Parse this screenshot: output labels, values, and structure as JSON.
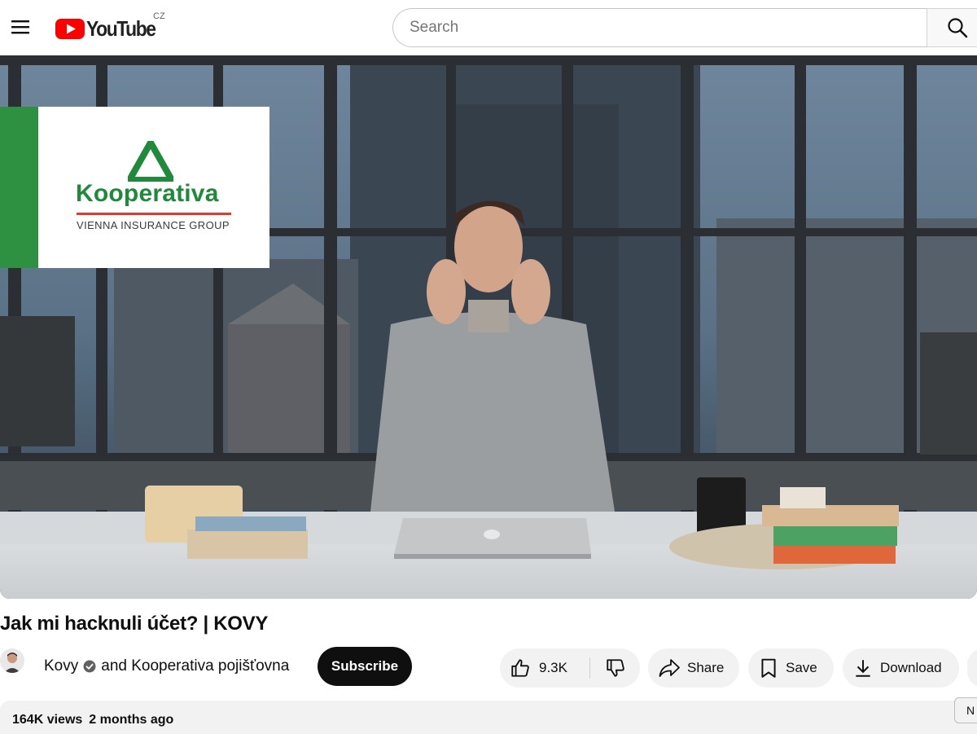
{
  "masthead": {
    "logo_text": "YouTube",
    "country_code": "CZ",
    "search_placeholder": "Search"
  },
  "video": {
    "overlay_brand": "Kooperativa",
    "overlay_tagline": "VIENNA INSURANCE GROUP",
    "title": "Jak mi hacknuli účet? | KOVY",
    "channel": "Kovy",
    "collaborator": "and Kooperativa pojišťovna",
    "subscribe_label": "Subscribe",
    "like_count": "9.3K",
    "share_label": "Share",
    "save_label": "Save",
    "download_label": "Download",
    "views": "164K views",
    "uploaded": "2 months ago",
    "side_chip": "N"
  },
  "colors": {
    "youtube_red": "#ff0000",
    "subscribe_bg": "#0f0f0f",
    "kooperativa_green": "#2e9142",
    "kooperativa_red": "#e03a31"
  },
  "icons": [
    "menu-icon",
    "youtube-logo-icon",
    "search-icon",
    "verified-icon",
    "like-icon",
    "dislike-icon",
    "share-icon",
    "save-icon",
    "download-icon"
  ]
}
